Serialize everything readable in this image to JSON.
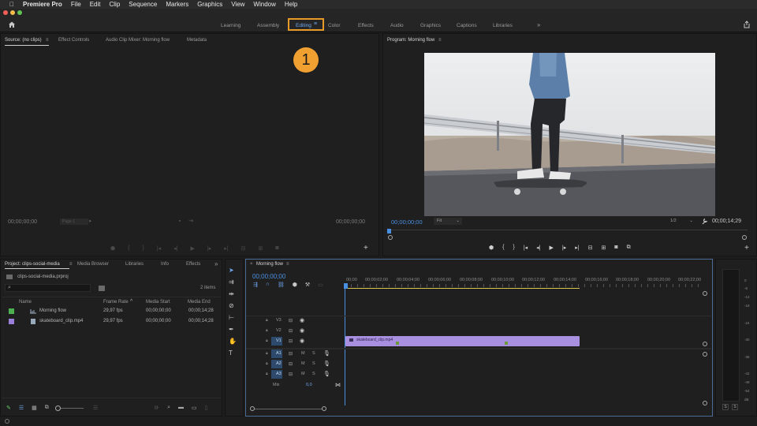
{
  "menubar": {
    "app": "Premiere Pro",
    "items": [
      "File",
      "Edit",
      "Clip",
      "Sequence",
      "Markers",
      "Graphics",
      "View",
      "Window",
      "Help"
    ]
  },
  "workspaces": {
    "tabs": [
      "Learning",
      "Assembly",
      "Editing",
      "Color",
      "Effects",
      "Audio",
      "Graphics",
      "Captions",
      "Libraries"
    ],
    "active": "Editing",
    "more": "»"
  },
  "callout": {
    "number": "1",
    "color": "#f0a030"
  },
  "source_panel": {
    "tabs": [
      "Source: (no clips)",
      "Effect Controls",
      "Audio Clip Mixer: Morning flow",
      "Metadata"
    ],
    "tc_left": "00;00;00;00",
    "page": "Page 1",
    "tc_right": "00;00;00;00"
  },
  "program_panel": {
    "title": "Program: Morning flow",
    "tc_current": "00;00;00;00",
    "fit": "Fit",
    "resolution": "1/2",
    "tc_duration": "00;00;14;29"
  },
  "project_panel": {
    "tabs": [
      "Project: clips-social-media",
      "Media Browser",
      "Libraries",
      "Info",
      "Effects"
    ],
    "more": "»",
    "file": "clips-social-media.prproj",
    "item_count": "2 items",
    "columns": [
      "Name",
      "Frame Rate",
      "Media Start",
      "Media End"
    ],
    "rows": [
      {
        "name": "Morning flow",
        "color": "#4caf50",
        "frame_rate": "29,97 fps",
        "start": "00;00;00;00",
        "end": "00;00;14;28"
      },
      {
        "name": "skateboard_clip.mp4",
        "color": "#9a7fd8",
        "frame_rate": "29,97 fps",
        "start": "00;00;00;00",
        "end": "00;00;14;28"
      }
    ]
  },
  "timeline": {
    "title": "Morning flow",
    "timecode": "00;00;00;00",
    "ruler": [
      "00;00",
      "00;00;02;00",
      "00;00;04;00",
      "00;00;06;00",
      "00;00;08;00",
      "00;00;10;00",
      "00;00;12;00",
      "00;00;14;00",
      "00;00;16;00",
      "00;00;18;00",
      "00;00;20;00",
      "00;00;22;00"
    ],
    "video_tracks": [
      "V3",
      "V2",
      "V1"
    ],
    "audio_tracks": [
      "A1",
      "A2",
      "A3"
    ],
    "mute": "M",
    "solo": "S",
    "mix_label": "Mix",
    "mix_value": "0,0",
    "clip_name": "skateboard_clip.mp4",
    "clip_color": "#a98fe0"
  },
  "meter": {
    "labels": [
      "0",
      "-6",
      "-12",
      "-18",
      "-24",
      "-30",
      "-36",
      "-42",
      "-48",
      "-54",
      "dB"
    ],
    "solo_buttons": [
      "S",
      "S"
    ]
  },
  "icons": [
    "home-icon",
    "share-icon",
    "selection-tool-icon",
    "track-select-icon",
    "ripple-edit-icon",
    "razor-icon",
    "slip-icon",
    "pen-icon",
    "hand-icon",
    "type-icon",
    "wrench-icon",
    "marker-icon",
    "play-icon",
    "step-back-icon",
    "step-forward-icon",
    "camera-icon",
    "lock-icon",
    "eye-icon",
    "mic-icon",
    "search-icon"
  ]
}
